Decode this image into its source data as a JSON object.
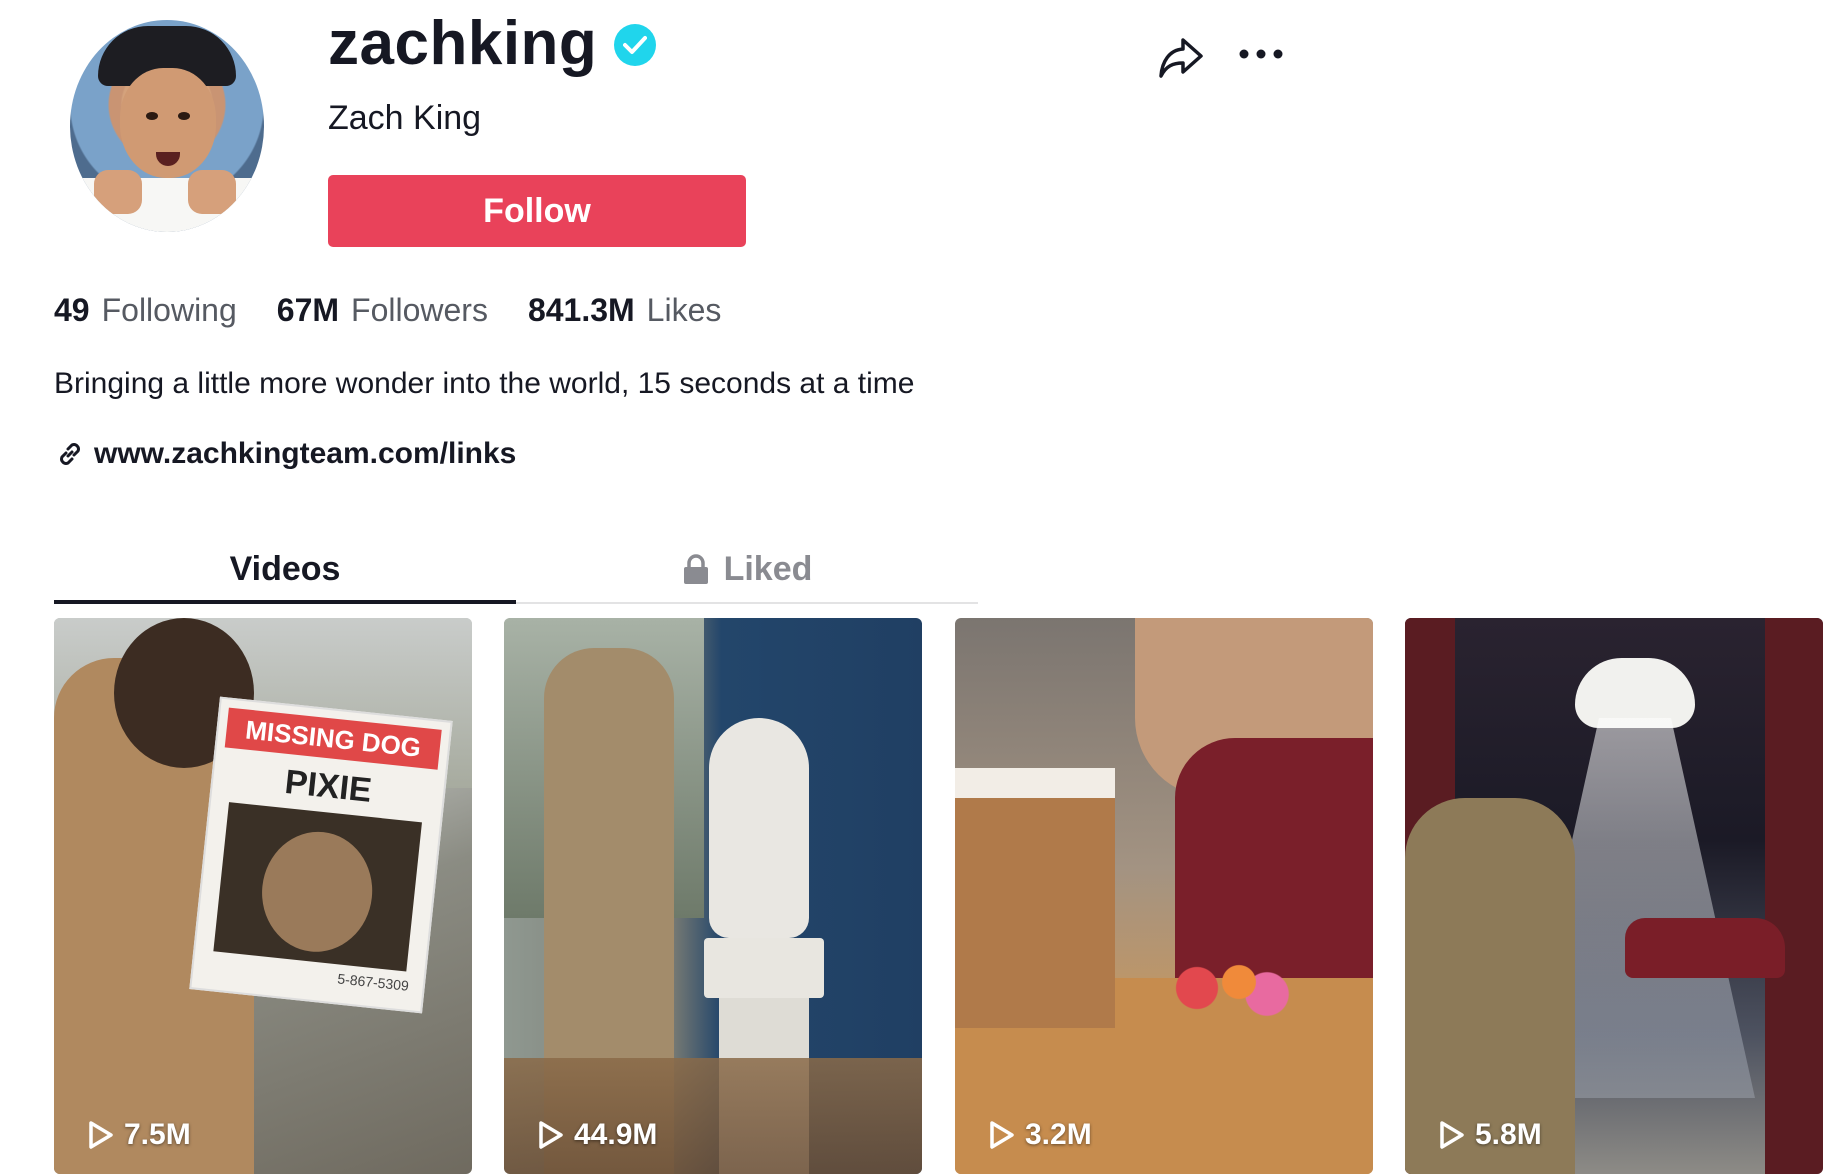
{
  "profile": {
    "username": "zachking",
    "nickname": "Zach King",
    "follow_label": "Follow",
    "verified": true,
    "stats": [
      {
        "value": "49",
        "label": "Following"
      },
      {
        "value": "67M",
        "label": "Followers"
      },
      {
        "value": "841.3M",
        "label": "Likes"
      }
    ],
    "bio": "Bringing a little more wonder into the world, 15 seconds at a time",
    "link": "www.zachkingteam.com/links"
  },
  "tabs": [
    {
      "label": "Videos",
      "active": true
    },
    {
      "label": "Liked",
      "locked": true
    }
  ],
  "videos": [
    {
      "views": "7.5M",
      "sign_top": "MISSING DOG",
      "sign_name": "PIXIE",
      "sign_phone": "5-867-5309"
    },
    {
      "views": "44.9M"
    },
    {
      "views": "3.2M"
    },
    {
      "views": "5.8M"
    }
  ],
  "colors": {
    "follow_button": "#e9425a",
    "verified_badge": "#20d5ec",
    "text_primary": "#161823",
    "text_secondary": "#565a62"
  },
  "icons": [
    "verified-badge-icon",
    "share-icon",
    "more-icon",
    "link-icon",
    "lock-icon",
    "play-icon"
  ]
}
